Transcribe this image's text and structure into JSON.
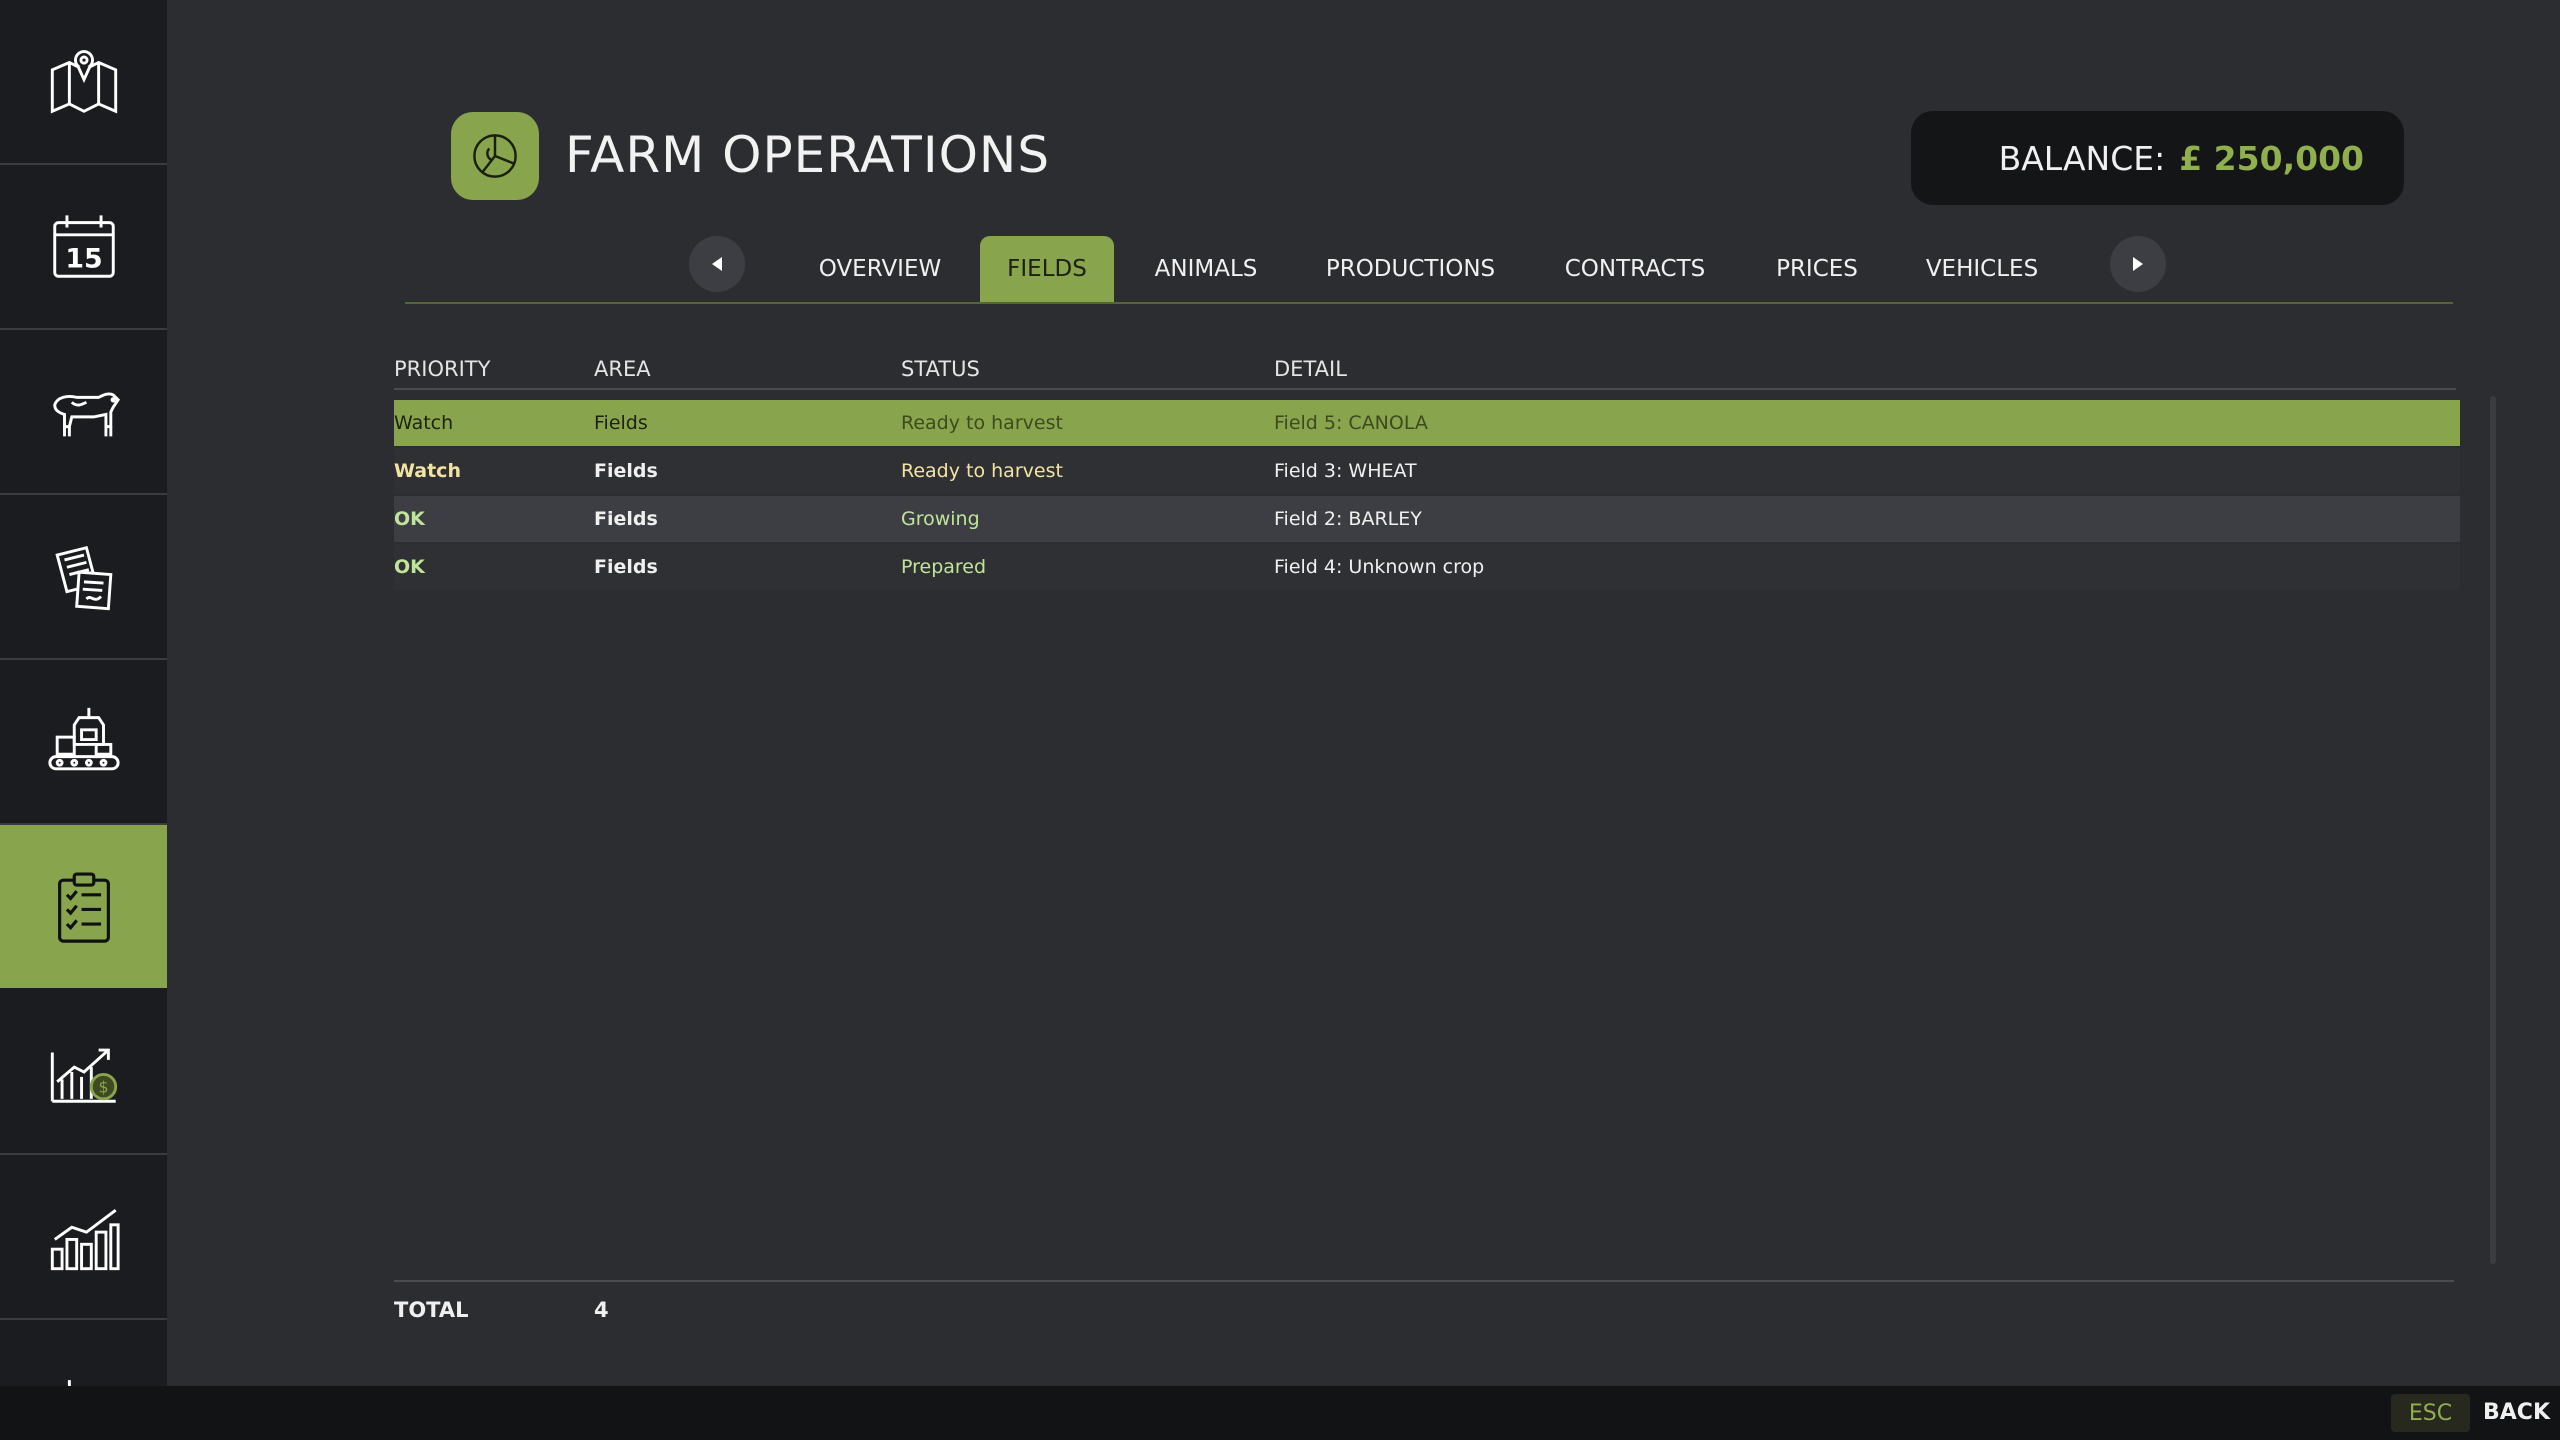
{
  "header": {
    "title": "FARM OPERATIONS",
    "balance_label": "BALANCE:",
    "balance_value": "£ 250,000"
  },
  "sidebar": {
    "items": [
      {
        "icon": "map-icon"
      },
      {
        "icon": "calendar-icon",
        "text": "15"
      },
      {
        "icon": "cow-icon"
      },
      {
        "icon": "documents-icon"
      },
      {
        "icon": "production-icon"
      },
      {
        "icon": "clipboard-checklist-icon",
        "active": true
      },
      {
        "icon": "finance-chart-icon"
      },
      {
        "icon": "statistics-chart-icon"
      }
    ]
  },
  "tabs": [
    "OVERVIEW",
    "FIELDS",
    "ANIMALS",
    "PRODUCTIONS",
    "CONTRACTS",
    "PRICES",
    "VEHICLES"
  ],
  "active_tab": "FIELDS",
  "table": {
    "headers": [
      "PRIORITY",
      "AREA",
      "STATUS",
      "DETAIL"
    ],
    "rows": [
      {
        "priority": "Watch",
        "area": "Fields",
        "status": "Ready to harvest",
        "detail": "Field 5: CANOLA"
      },
      {
        "priority": "Watch",
        "area": "Fields",
        "status": "Ready to harvest",
        "detail": "Field 3: WHEAT"
      },
      {
        "priority": "OK",
        "area": "Fields",
        "status": "Growing",
        "detail": "Field 2: BARLEY"
      },
      {
        "priority": "OK",
        "area": "Fields",
        "status": "Prepared",
        "detail": "Field 4: Unknown crop"
      }
    ]
  },
  "footer": {
    "total_label": "TOTAL",
    "total_value": "4"
  },
  "bottombar": {
    "esc_key": "ESC",
    "back_label": "BACK"
  },
  "colors": {
    "accent": "#88a44c",
    "watch": "#f3e3a2",
    "ok": "#bfe49a",
    "balance_value": "#8fb04d"
  }
}
